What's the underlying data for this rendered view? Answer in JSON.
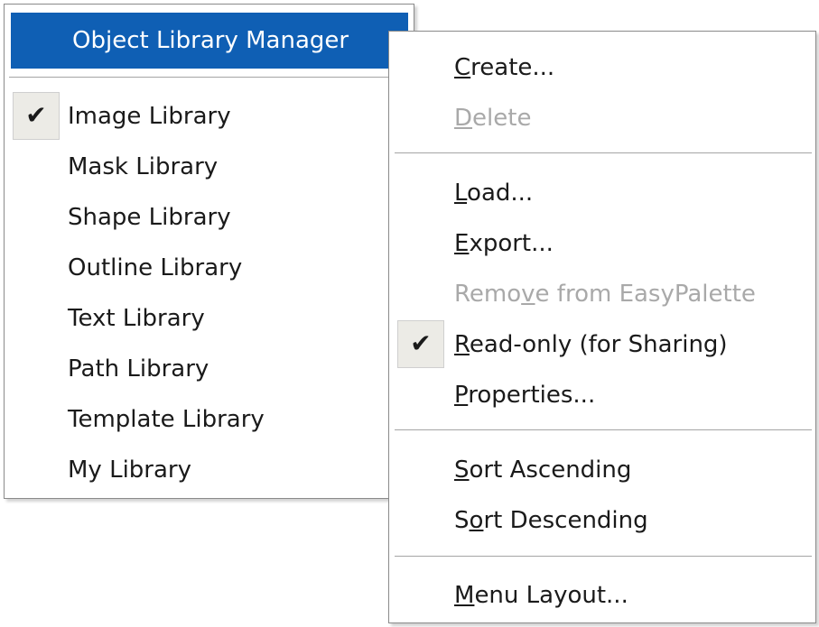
{
  "main_menu": {
    "header_label": "Object Library Manager",
    "items": [
      {
        "label": "Image Library",
        "checked": true
      },
      {
        "label": "Mask Library",
        "checked": false
      },
      {
        "label": "Shape Library",
        "checked": false
      },
      {
        "label": "Outline Library",
        "checked": false
      },
      {
        "label": "Text Library",
        "checked": false
      },
      {
        "label": "Path Library",
        "checked": false
      },
      {
        "label": "Template Library",
        "checked": false
      },
      {
        "label": "My Library",
        "checked": false
      }
    ]
  },
  "submenu": {
    "items": [
      {
        "before": "",
        "accel": "C",
        "after": "reate...",
        "disabled": false,
        "checked": false
      },
      {
        "before": "",
        "accel": "D",
        "after": "elete",
        "disabled": true,
        "checked": false
      },
      {
        "before": "",
        "accel": "L",
        "after": "oad...",
        "disabled": false,
        "checked": false
      },
      {
        "before": "",
        "accel": "E",
        "after": "xport...",
        "disabled": false,
        "checked": false
      },
      {
        "before": "Remo",
        "accel": "v",
        "after": "e from EasyPalette",
        "disabled": true,
        "checked": false
      },
      {
        "before": "",
        "accel": "R",
        "after": "ead-only (for Sharing)",
        "disabled": false,
        "checked": true
      },
      {
        "before": "",
        "accel": "P",
        "after": "roperties...",
        "disabled": false,
        "checked": false
      },
      {
        "before": "",
        "accel": "S",
        "after": "ort Ascending",
        "disabled": false,
        "checked": false
      },
      {
        "before": "S",
        "accel": "o",
        "after": "rt Descending",
        "disabled": false,
        "checked": false
      },
      {
        "before": "",
        "accel": "M",
        "after": "enu Layout...",
        "disabled": false,
        "checked": false
      }
    ]
  },
  "icons": {
    "check": "checkmark-icon",
    "submenu_arrow": "submenu-arrow-icon"
  },
  "check_glyph": "✔",
  "colors": {
    "highlight": "#0f5fb4",
    "disabled_text": "#a9a9a9",
    "check_background": "#ecebe6"
  }
}
